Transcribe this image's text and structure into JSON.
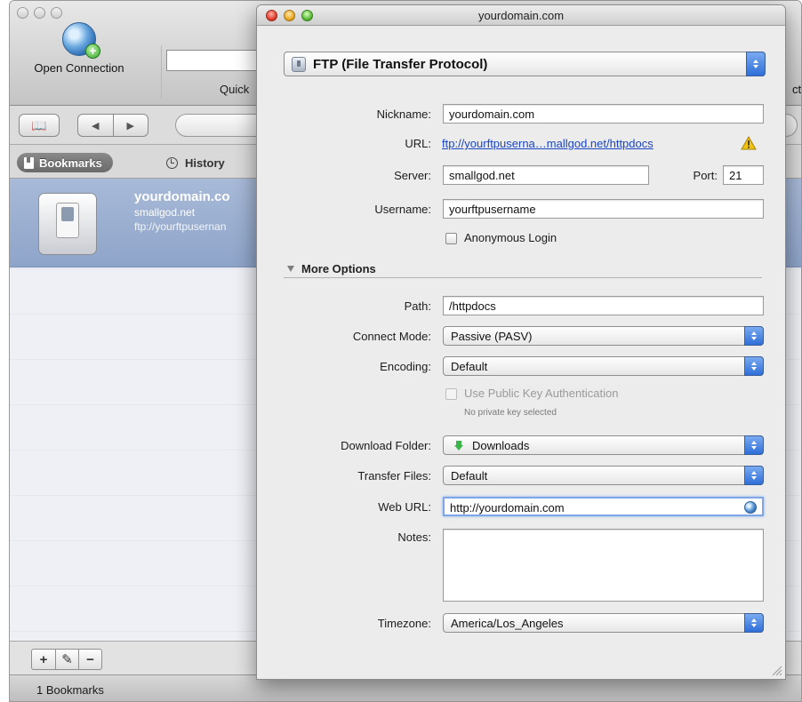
{
  "main_window": {
    "toolbar": {
      "open_connection_label": "Open Connection",
      "quick_connect_label": "Quick",
      "right_fragment": "ct"
    },
    "tabs": {
      "bookmarks_label": "Bookmarks",
      "history_label": "History"
    },
    "bookmark": {
      "title": "yourdomain.co",
      "server": "smallgod.net",
      "url": "ftp://yourftpusernan"
    },
    "bottom_buttons": {
      "add": "+",
      "edit": "✎",
      "remove": "−"
    },
    "status": "1 Bookmarks"
  },
  "sheet": {
    "window_title": "yourdomain.com",
    "protocol": "FTP (File Transfer Protocol)",
    "labels": {
      "nickname": "Nickname:",
      "url": "URL:",
      "server": "Server:",
      "port": "Port:",
      "username": "Username:",
      "anonymous": "Anonymous Login",
      "more_options": "More Options",
      "path": "Path:",
      "connect_mode": "Connect Mode:",
      "encoding": "Encoding:",
      "public_key": "Use Public Key Authentication",
      "public_key_note": "No private key selected",
      "download_folder": "Download Folder:",
      "transfer_files": "Transfer Files:",
      "web_url": "Web URL:",
      "notes": "Notes:",
      "timezone": "Timezone:"
    },
    "values": {
      "nickname": "yourdomain.com",
      "url": "ftp://yourftpuserna…mallgod.net/httpdocs",
      "server": "smallgod.net",
      "port": "21",
      "username": "yourftpusername",
      "anonymous_checked": false,
      "path": "/httpdocs",
      "connect_mode": "Passive (PASV)",
      "encoding": "Default",
      "public_key_checked": false,
      "download_folder": "Downloads",
      "transfer_files": "Default",
      "web_url": "http://yourdomain.com",
      "notes": "",
      "timezone": "America/Los_Angeles"
    }
  },
  "colors": {
    "selection_row": "#9bb0d3",
    "link": "#1a45c4",
    "popup_arrows": "#2e6fd8",
    "warning": "#f1c40f"
  }
}
